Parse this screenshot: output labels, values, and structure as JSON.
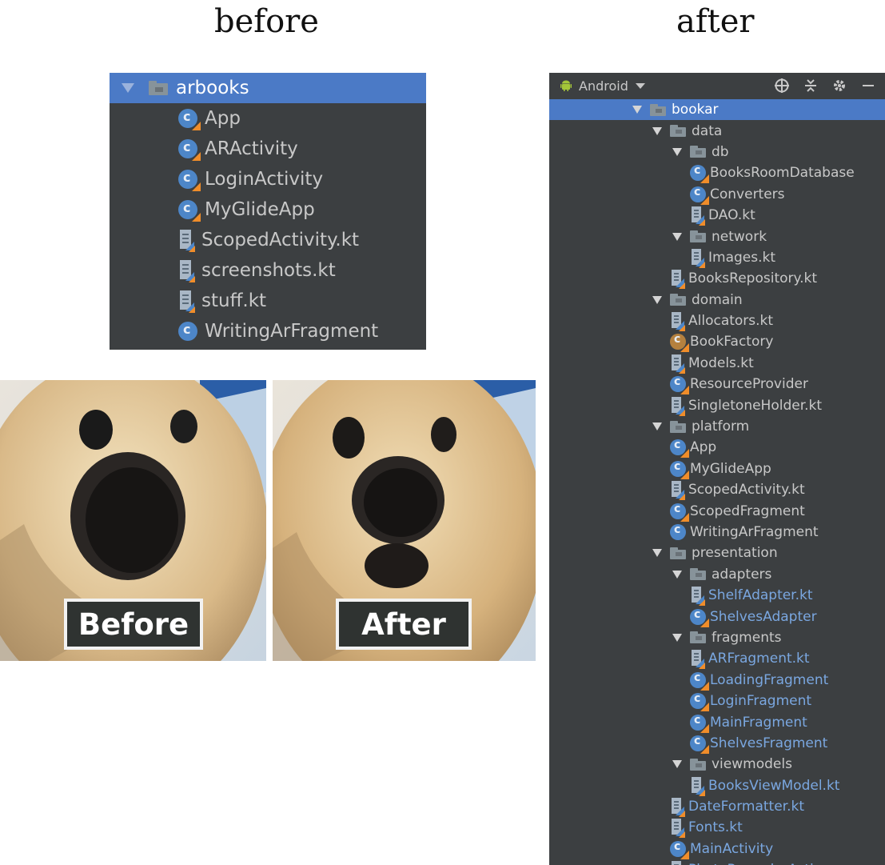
{
  "headings": {
    "before": "before",
    "after": "after"
  },
  "before_tree": {
    "root": {
      "label": "arbooks",
      "icon": "folder-icon"
    },
    "items": [
      {
        "label": "App",
        "icon": "kotlin-class-icon"
      },
      {
        "label": "ARActivity",
        "icon": "kotlin-class-icon"
      },
      {
        "label": "LoginActivity",
        "icon": "kotlin-class-icon"
      },
      {
        "label": "MyGlideApp",
        "icon": "kotlin-class-icon"
      },
      {
        "label": "ScopedActivity.kt",
        "icon": "kotlin-file-icon"
      },
      {
        "label": "screenshots.kt",
        "icon": "kotlin-file-icon"
      },
      {
        "label": "stuff.kt",
        "icon": "kotlin-file-icon"
      },
      {
        "label": "WritingArFragment",
        "icon": "class-icon"
      }
    ]
  },
  "photos": {
    "before_caption": "Before",
    "after_caption": "After"
  },
  "project_panel": {
    "view_selector": "Android",
    "toolbar_icons": [
      "locate-icon",
      "collapse-all-icon",
      "settings-icon",
      "hide-icon"
    ],
    "tree": [
      {
        "label": "bookar",
        "kind": "folder",
        "depth": 0,
        "selected": true
      },
      {
        "label": "data",
        "kind": "folder",
        "depth": 1
      },
      {
        "label": "db",
        "kind": "folder",
        "depth": 2
      },
      {
        "label": "BooksRoomDatabase",
        "kind": "kclass",
        "depth": 3
      },
      {
        "label": "Converters",
        "kind": "kclass",
        "depth": 3
      },
      {
        "label": "DAO.kt",
        "kind": "file",
        "depth": 3
      },
      {
        "label": "network",
        "kind": "folder",
        "depth": 2
      },
      {
        "label": "Images.kt",
        "kind": "file",
        "depth": 3
      },
      {
        "label": "BooksRepository.kt",
        "kind": "file",
        "depth": 2
      },
      {
        "label": "domain",
        "kind": "folder",
        "depth": 1
      },
      {
        "label": "Allocators.kt",
        "kind": "file",
        "depth": 2
      },
      {
        "label": "BookFactory",
        "kind": "oclass",
        "depth": 2
      },
      {
        "label": "Models.kt",
        "kind": "file",
        "depth": 2
      },
      {
        "label": "ResourceProvider",
        "kind": "kclass",
        "depth": 2
      },
      {
        "label": "SingletoneHolder.kt",
        "kind": "file",
        "depth": 2
      },
      {
        "label": "platform",
        "kind": "folder",
        "depth": 1
      },
      {
        "label": "App",
        "kind": "kclass",
        "depth": 2
      },
      {
        "label": "MyGlideApp",
        "kind": "kclass",
        "depth": 2
      },
      {
        "label": "ScopedActivity.kt",
        "kind": "file",
        "depth": 2
      },
      {
        "label": "ScopedFragment",
        "kind": "kclass",
        "depth": 2
      },
      {
        "label": "WritingArFragment",
        "kind": "class",
        "depth": 2
      },
      {
        "label": "presentation",
        "kind": "folder",
        "depth": 1
      },
      {
        "label": "adapters",
        "kind": "folder",
        "depth": 2
      },
      {
        "label": "ShelfAdapter.kt",
        "kind": "file",
        "depth": 3,
        "vcs": true
      },
      {
        "label": "ShelvesAdapter",
        "kind": "kclass",
        "depth": 3,
        "vcs": true
      },
      {
        "label": "fragments",
        "kind": "folder",
        "depth": 2
      },
      {
        "label": "ARFragment.kt",
        "kind": "file",
        "depth": 3,
        "vcs": true
      },
      {
        "label": "LoadingFragment",
        "kind": "kclass",
        "depth": 3,
        "vcs": true
      },
      {
        "label": "LoginFragment",
        "kind": "kclass",
        "depth": 3,
        "vcs": true
      },
      {
        "label": "MainFragment",
        "kind": "kclass",
        "depth": 3,
        "vcs": true
      },
      {
        "label": "ShelvesFragment",
        "kind": "kclass",
        "depth": 3,
        "vcs": true
      },
      {
        "label": "viewmodels",
        "kind": "folder",
        "depth": 2
      },
      {
        "label": "BooksViewModel.kt",
        "kind": "file",
        "depth": 3,
        "vcs": true
      },
      {
        "label": "DateFormatter.kt",
        "kind": "file",
        "depth": 2,
        "vcs": true
      },
      {
        "label": "Fonts.kt",
        "kind": "file",
        "depth": 2,
        "vcs": true
      },
      {
        "label": "MainActivity",
        "kind": "kclass",
        "depth": 2,
        "vcs": true
      },
      {
        "label": "PhotoRecorderActi...",
        "kind": "file",
        "depth": 2,
        "vcs": true
      }
    ]
  },
  "colors": {
    "panel_bg": "#3c3f41",
    "selection": "#4b7ac6",
    "text": "#c8c8c8",
    "vcs_modified": "#7aa7e0",
    "class_icon": "#4d86c8",
    "kotlin_accent": "#f08d2a"
  }
}
